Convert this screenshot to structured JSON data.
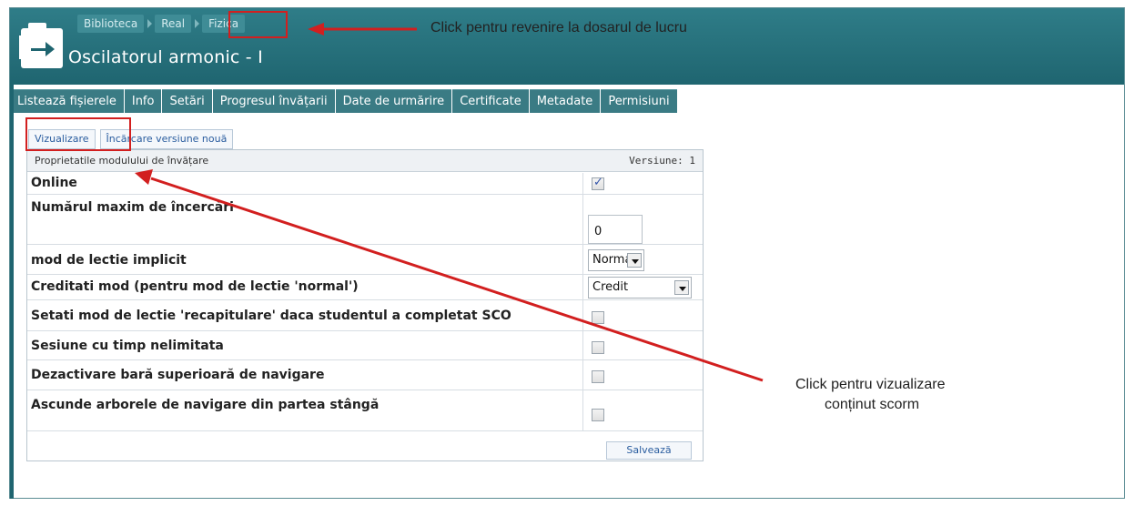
{
  "breadcrumb": {
    "items": [
      "Biblioteca",
      "Real",
      "Fizica"
    ]
  },
  "page": {
    "title": "Oscilatorul armonic - I"
  },
  "tabs": [
    {
      "label": "Listează fișierele"
    },
    {
      "label": "Info"
    },
    {
      "label": "Setări"
    },
    {
      "label": "Progresul învățarii"
    },
    {
      "label": "Date de urmărire"
    },
    {
      "label": "Certificate"
    },
    {
      "label": "Metadate"
    },
    {
      "label": "Permisiuni"
    }
  ],
  "subtabs": [
    {
      "label": "Vizualizare"
    },
    {
      "label": "Încărcare versiune nouă"
    }
  ],
  "panel": {
    "title": "Proprietatile modulului de învățare",
    "version": "Versiune: 1",
    "rows": [
      {
        "label": "Online",
        "checked": true
      },
      {
        "label": "Numărul maxim de încercări",
        "value": "0"
      },
      {
        "label": "mod de lectie implicit",
        "selected": "Normal"
      },
      {
        "label": "Creditati mod (pentru mod de lectie 'normal')",
        "selected": "Credit"
      },
      {
        "label": "Setati mod de lectie 'recapitulare' daca studentul a completat SCO",
        "checked": false
      },
      {
        "label": "Sesiune cu timp nelimitata",
        "checked": false
      },
      {
        "label": "Dezactivare bară superioară de navigare",
        "checked": false
      },
      {
        "label": "Ascunde arborele de navigare din partea stângă",
        "checked": false
      }
    ],
    "save_label": "Salvează"
  },
  "annotations": {
    "breadcrumb_note": "Click pentru revenire la dosarul de lucru",
    "view_note_line1": "Click pentru vizualizare",
    "view_note_line2": "conținut scorm"
  },
  "colors": {
    "header": "#2f7d88",
    "arrow": "#d21f1f",
    "tab": "#3a7b84"
  }
}
